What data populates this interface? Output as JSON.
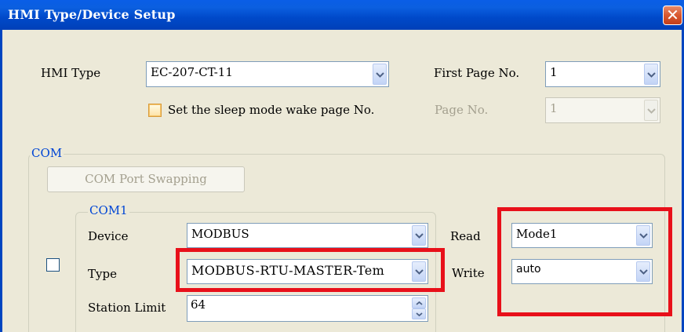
{
  "window": {
    "title": "HMI Type/Device Setup",
    "close_glyph": "✕"
  },
  "hmi": {
    "type_label": "HMI Type",
    "type_value": "EC-207-CT-11",
    "first_page_label": "First Page No.",
    "first_page_value": "1",
    "sleep_checkbox_label": "Set the sleep mode wake page No.",
    "page_no_label": "Page No.",
    "page_no_value": "1"
  },
  "com": {
    "group_title": "COM",
    "swap_button": "COM Port Swapping",
    "com1": {
      "group_title": "COM1",
      "device_label": "Device",
      "device_value": "MODBUS",
      "type_label": "Type",
      "type_value": "MODBUS-RTU-MASTER-Tem",
      "station_limit_label": "Station Limit",
      "station_limit_value": "64",
      "read_label": "Read",
      "read_value": "Mode1",
      "write_label": "Write",
      "write_value": "auto"
    }
  },
  "colors": {
    "highlight": "#e8101a",
    "title_bar": "#0049c9",
    "group_title": "#0046d5"
  },
  "icons": [
    "close-icon",
    "chevron-down-icon",
    "spin-up-icon",
    "spin-down-icon"
  ]
}
